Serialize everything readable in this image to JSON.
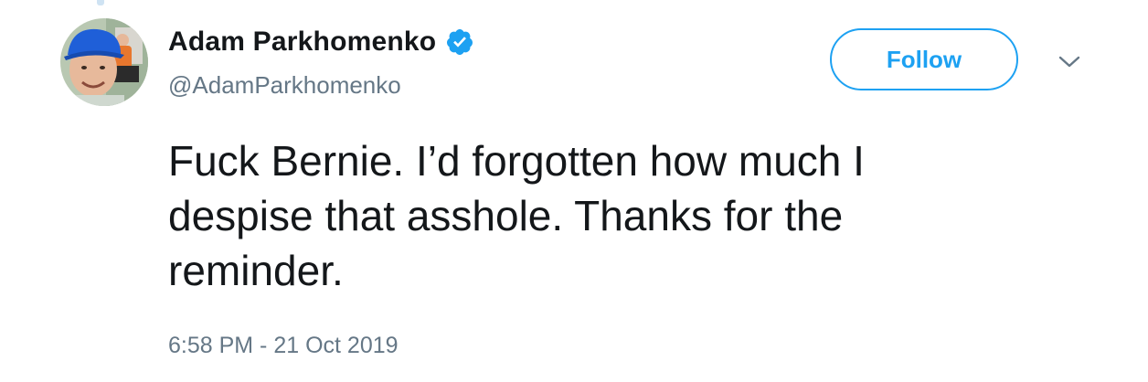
{
  "tweet": {
    "author": {
      "display_name": "Adam Parkhomenko",
      "handle": "@AdamParkhomenko",
      "verified": true,
      "avatar_icon": "avatar-photo"
    },
    "follow_label": "Follow",
    "menu_icon": "chevron-down-icon",
    "text": "Fuck Bernie. I’d forgotten how much I\ndespise that asshole. Thanks for the\nreminder.",
    "timestamp": "6:58 PM - 21 Oct 2019"
  },
  "colors": {
    "accent": "#1da1f2",
    "text_primary": "#14171a",
    "text_secondary": "#657786"
  }
}
